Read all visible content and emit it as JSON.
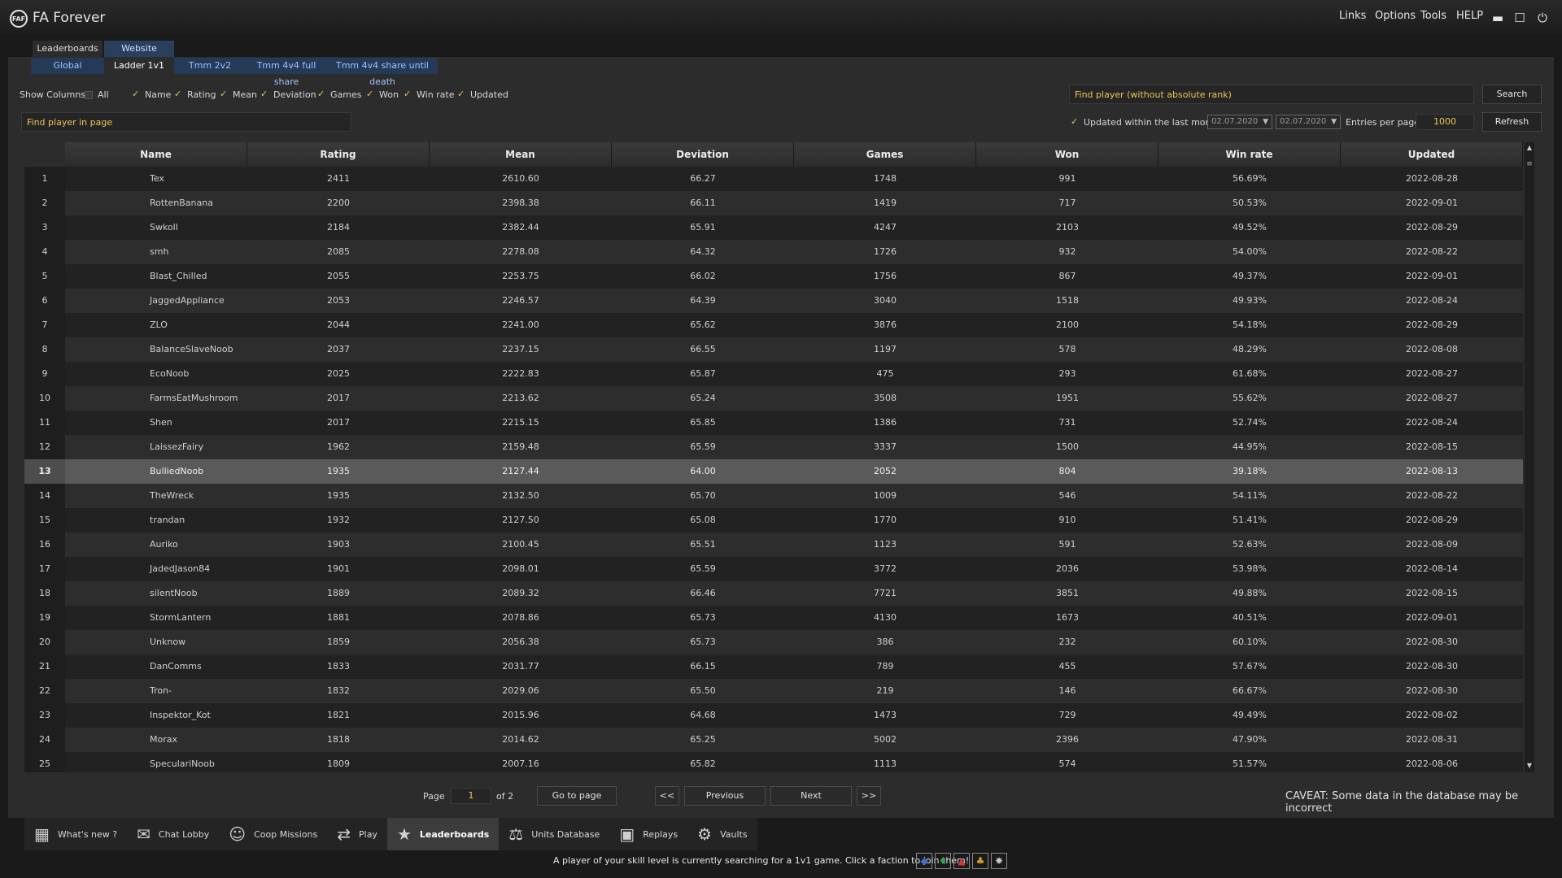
{
  "app": {
    "logo_text": "FAF",
    "title": "FA Forever"
  },
  "menu": [
    "Links",
    "Options",
    "Tools",
    "HELP"
  ],
  "tabs": {
    "top": [
      {
        "label": "Leaderboards",
        "active": true
      },
      {
        "label": "Website",
        "active": false
      }
    ],
    "sub": [
      {
        "label": "Global",
        "active": false
      },
      {
        "label": "Ladder 1v1",
        "active": true
      },
      {
        "label": "Tmm 2v2",
        "active": false
      },
      {
        "label": "Tmm 4v4 full share",
        "active": false
      },
      {
        "label": "Tmm 4v4 share until death",
        "active": false
      }
    ]
  },
  "filters": {
    "show_columns_label": "Show Columns:",
    "all_label": "All",
    "columns": [
      {
        "label": "Name",
        "checked": true
      },
      {
        "label": "Rating",
        "checked": true
      },
      {
        "label": "Mean",
        "checked": true
      },
      {
        "label": "Deviation",
        "checked": true
      },
      {
        "label": "Games",
        "checked": true
      },
      {
        "label": "Won",
        "checked": true
      },
      {
        "label": "Win rate",
        "checked": true
      },
      {
        "label": "Updated",
        "checked": true
      }
    ],
    "find_player_placeholder": "Find player (without absolute rank)",
    "search_button": "Search",
    "find_in_page_placeholder": "Find player in page",
    "updated_label": "Updated within the last month",
    "date_from": "02.07.2020",
    "date_to": "02.07.2020",
    "entries_label": "Entries per page",
    "entries_value": "1000",
    "refresh_button": "Refresh"
  },
  "table": {
    "headers": [
      "Name",
      "Rating",
      "Mean",
      "Deviation",
      "Games",
      "Won",
      "Win rate",
      "Updated"
    ],
    "selected_row": 13,
    "rows": [
      [
        "1",
        "Tex",
        "2411",
        "2610.60",
        "66.27",
        "1748",
        "991",
        "56.69%",
        "2022-08-28"
      ],
      [
        "2",
        "RottenBanana",
        "2200",
        "2398.38",
        "66.11",
        "1419",
        "717",
        "50.53%",
        "2022-09-01"
      ],
      [
        "3",
        "Swkoll",
        "2184",
        "2382.44",
        "65.91",
        "4247",
        "2103",
        "49.52%",
        "2022-08-29"
      ],
      [
        "4",
        "smh",
        "2085",
        "2278.08",
        "64.32",
        "1726",
        "932",
        "54.00%",
        "2022-08-22"
      ],
      [
        "5",
        "Blast_Chilled",
        "2055",
        "2253.75",
        "66.02",
        "1756",
        "867",
        "49.37%",
        "2022-09-01"
      ],
      [
        "6",
        "JaggedAppliance",
        "2053",
        "2246.57",
        "64.39",
        "3040",
        "1518",
        "49.93%",
        "2022-08-24"
      ],
      [
        "7",
        "ZLO",
        "2044",
        "2241.00",
        "65.62",
        "3876",
        "2100",
        "54.18%",
        "2022-08-29"
      ],
      [
        "8",
        "BalanceSlaveNoob",
        "2037",
        "2237.15",
        "66.55",
        "1197",
        "578",
        "48.29%",
        "2022-08-08"
      ],
      [
        "9",
        "EcoNoob",
        "2025",
        "2222.83",
        "65.87",
        "475",
        "293",
        "61.68%",
        "2022-08-27"
      ],
      [
        "10",
        "FarmsEatMushroom",
        "2017",
        "2213.62",
        "65.24",
        "3508",
        "1951",
        "55.62%",
        "2022-08-27"
      ],
      [
        "11",
        "Shen",
        "2017",
        "2215.15",
        "65.85",
        "1386",
        "731",
        "52.74%",
        "2022-08-24"
      ],
      [
        "12",
        "LaissezFairy",
        "1962",
        "2159.48",
        "65.59",
        "3337",
        "1500",
        "44.95%",
        "2022-08-15"
      ],
      [
        "13",
        "BulliedNoob",
        "1935",
        "2127.44",
        "64.00",
        "2052",
        "804",
        "39.18%",
        "2022-08-13"
      ],
      [
        "14",
        "TheWreck",
        "1935",
        "2132.50",
        "65.70",
        "1009",
        "546",
        "54.11%",
        "2022-08-22"
      ],
      [
        "15",
        "trandan",
        "1932",
        "2127.50",
        "65.08",
        "1770",
        "910",
        "51.41%",
        "2022-08-29"
      ],
      [
        "16",
        "Auriko",
        "1903",
        "2100.45",
        "65.51",
        "1123",
        "591",
        "52.63%",
        "2022-08-09"
      ],
      [
        "17",
        "JadedJason84",
        "1901",
        "2098.01",
        "65.59",
        "3772",
        "2036",
        "53.98%",
        "2022-08-14"
      ],
      [
        "18",
        "silentNoob",
        "1889",
        "2089.32",
        "66.46",
        "7721",
        "3851",
        "49.88%",
        "2022-08-15"
      ],
      [
        "19",
        "StormLantern",
        "1881",
        "2078.86",
        "65.73",
        "4130",
        "1673",
        "40.51%",
        "2022-09-01"
      ],
      [
        "20",
        "Unknow",
        "1859",
        "2056.38",
        "65.73",
        "386",
        "232",
        "60.10%",
        "2022-08-30"
      ],
      [
        "21",
        "DanComms",
        "1833",
        "2031.77",
        "66.15",
        "789",
        "455",
        "57.67%",
        "2022-08-30"
      ],
      [
        "22",
        "Tron-",
        "1832",
        "2029.06",
        "65.50",
        "219",
        "146",
        "66.67%",
        "2022-08-30"
      ],
      [
        "23",
        "Inspektor_Kot",
        "1821",
        "2015.96",
        "64.68",
        "1473",
        "729",
        "49.49%",
        "2022-08-02"
      ],
      [
        "24",
        "Morax",
        "1818",
        "2014.62",
        "65.25",
        "5002",
        "2396",
        "47.90%",
        "2022-08-31"
      ],
      [
        "25",
        "SpeculariNoob",
        "1809",
        "2007.16",
        "65.82",
        "1113",
        "574",
        "51.57%",
        "2022-08-06"
      ]
    ]
  },
  "pager": {
    "page_label": "Page",
    "page_value": "1",
    "of_label": "of",
    "total_pages": "2",
    "go_button": "Go to page",
    "first_button": "<<",
    "prev_button": "Previous",
    "next_button": "Next",
    "last_button": ">>"
  },
  "caveat": "CAVEAT: Some data in the database may be incorrect",
  "nav": [
    {
      "label": "What's new ?",
      "icon": "rss-icon",
      "glyph": "▦",
      "active": false
    },
    {
      "label": "Chat Lobby",
      "icon": "chat-icon",
      "glyph": "✉",
      "active": false
    },
    {
      "label": "Coop Missions",
      "icon": "coop-icon",
      "glyph": "☺",
      "active": false
    },
    {
      "label": "Play",
      "icon": "shuffle-icon",
      "glyph": "⇄",
      "active": false
    },
    {
      "label": "Leaderboards",
      "icon": "trophy-icon",
      "glyph": "★",
      "active": true
    },
    {
      "label": "Units Database",
      "icon": "scales-icon",
      "glyph": "⚖",
      "active": false
    },
    {
      "label": "Replays",
      "icon": "tv-icon",
      "glyph": "▣",
      "active": false
    },
    {
      "label": "Vaults",
      "icon": "vault-icon",
      "glyph": "⚙",
      "active": false
    }
  ],
  "status_text": "A player of your skill level is currently searching for a 1v1 game. Click a faction to join them!",
  "factions": [
    {
      "name": "uef-faction-icon",
      "glyph": "◆",
      "color": "#3b6fd1"
    },
    {
      "name": "cybran-faction-icon",
      "glyph": "♦",
      "color": "#2aa84a"
    },
    {
      "name": "aeon-faction-icon",
      "glyph": "▲",
      "color": "#d03a3a"
    },
    {
      "name": "seraphim-faction-icon",
      "glyph": "♣",
      "color": "#d9a028"
    },
    {
      "name": "random-faction-icon",
      "glyph": "✸",
      "color": "#c8c8c8"
    }
  ]
}
